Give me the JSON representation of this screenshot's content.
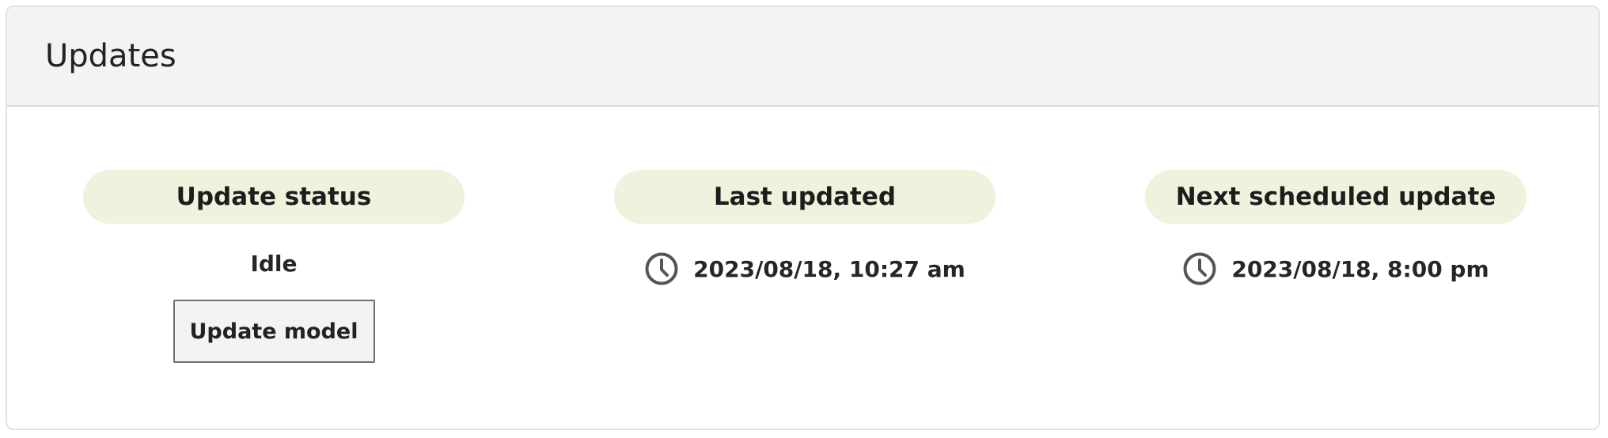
{
  "panel": {
    "title": "Updates"
  },
  "status": {
    "heading": "Update status",
    "value": "Idle",
    "button_label": "Update model"
  },
  "last_updated": {
    "heading": "Last updated",
    "value": "2023/08/18, 10:27 am",
    "icon": "clock-icon"
  },
  "next_update": {
    "heading": "Next scheduled update",
    "value": "2023/08/18, 8:00 pm",
    "icon": "clock-icon"
  },
  "colors": {
    "header_bg": "#f4f3f1",
    "pill_bg": "#eef3dd",
    "icon_color": "#555555"
  }
}
